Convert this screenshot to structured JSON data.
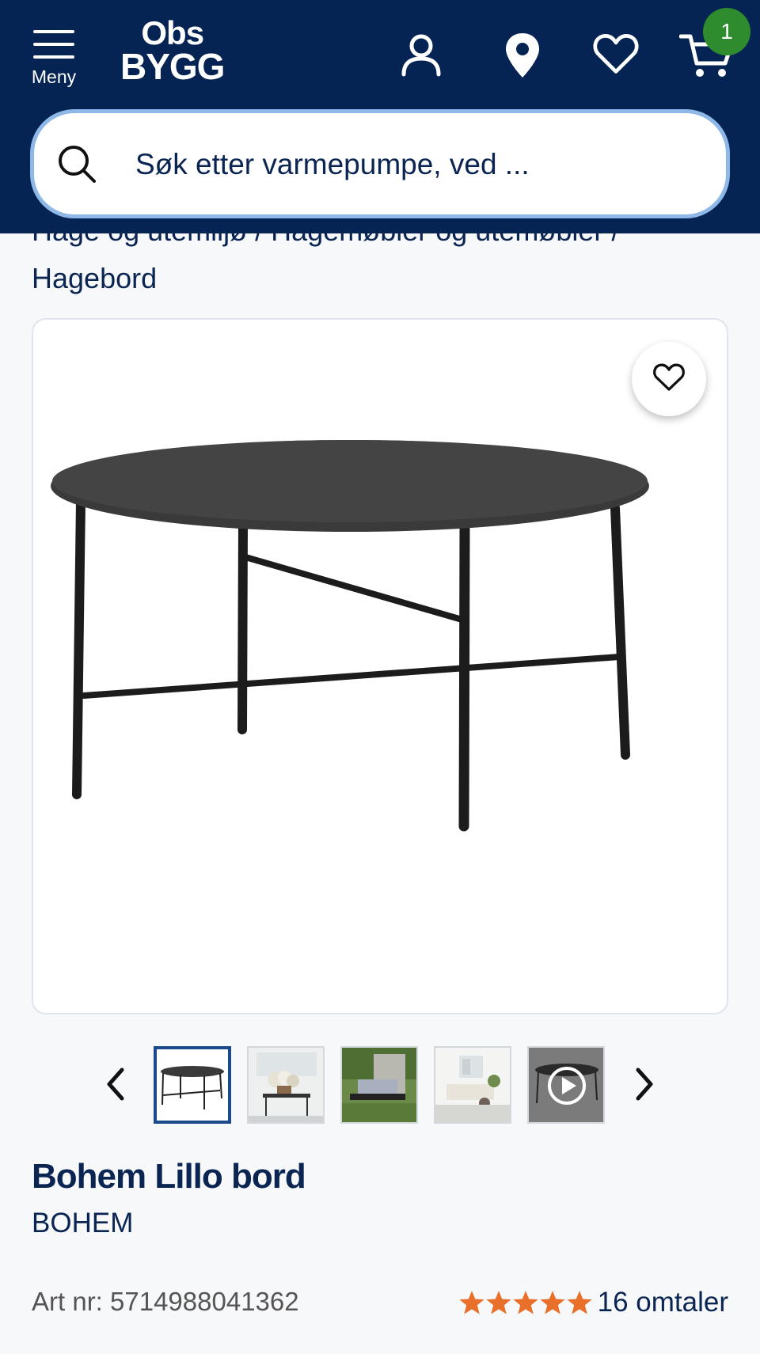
{
  "header": {
    "menu_label": "Meny",
    "logo_line1": "Obs",
    "logo_line2": "BYGG",
    "cart_count": "1"
  },
  "search": {
    "placeholder": "Søk etter varmepumpe, ved ..."
  },
  "breadcrumb": {
    "items": [
      "Hage og utemiljø",
      "Hagemøbler og utemøbler"
    ],
    "current": "Hagebord"
  },
  "gallery": {
    "thumbnail_count": 5,
    "active_index": 0,
    "last_thumbnail_type": "video"
  },
  "product": {
    "name": "Bohem Lillo bord",
    "brand": "BOHEM",
    "art_nr_label": "Art nr: 5714988041362",
    "rating_stars": 5,
    "reviews_label": "16 omtaler"
  },
  "colors": {
    "header_bg": "#052453",
    "search_border": "#8db8e8",
    "badge": "#2e8b2e",
    "star": "#e8702a",
    "text_primary": "#0b2553"
  }
}
